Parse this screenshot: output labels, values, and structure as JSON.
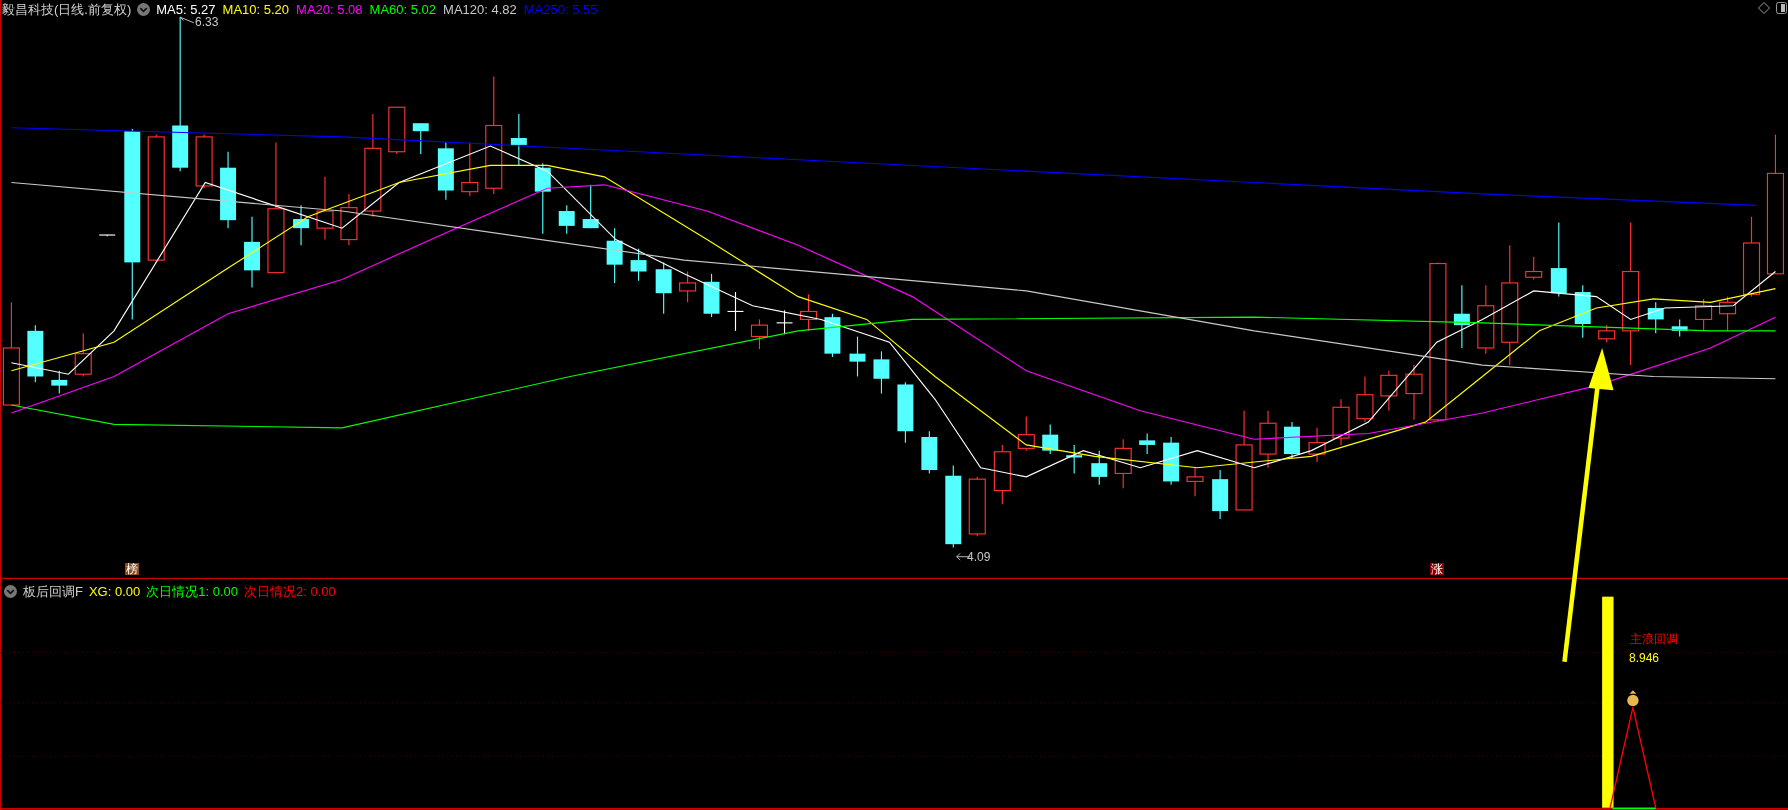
{
  "window": {
    "title": "毅昌科技(日线.前复权)"
  },
  "moving_averages": [
    {
      "label": "MA5: 5.27",
      "color": "#ffffff"
    },
    {
      "label": "MA10: 5.20",
      "color": "#ffff00"
    },
    {
      "label": "MA20: 5.08",
      "color": "#ff00ff"
    },
    {
      "label": "MA60: 5.02",
      "color": "#00ff00"
    },
    {
      "label": "MA120: 4.82",
      "color": "#c8c8c8"
    },
    {
      "label": "MA250: 5.55",
      "color": "#0000ff"
    }
  ],
  "price_chart": {
    "high_label": "6.33",
    "low_label": "4.09",
    "markers": [
      {
        "kind": "list",
        "text": "榜"
      },
      {
        "kind": "rise",
        "text": "涨"
      }
    ]
  },
  "indicator": {
    "name": "板后回调F",
    "values": [
      {
        "label": "XG: 0.00",
        "color": "#ffff00"
      },
      {
        "label": "次日情况1: 0.00",
        "color": "#00ff00"
      },
      {
        "label": "次日情况2: 0.00",
        "color": "#ff0000"
      }
    ],
    "signal_label": "主浪回调",
    "signal_value": "8.946"
  }
}
